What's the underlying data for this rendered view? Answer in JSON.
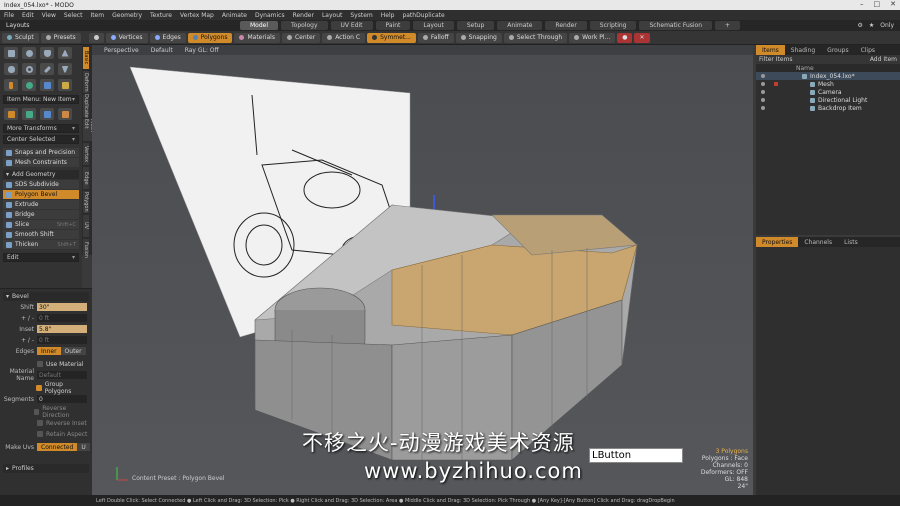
{
  "window": {
    "title": "Index_054.lxo* - MODO",
    "controls": [
      "–",
      "□",
      "✕"
    ]
  },
  "menu": [
    "File",
    "Edit",
    "View",
    "Select",
    "Item",
    "Geometry",
    "Texture",
    "Vertex Map",
    "Animate",
    "Dynamics",
    "Render",
    "Layout",
    "System",
    "Help",
    "pathDuplicate"
  ],
  "layouts": {
    "label": "Layouts",
    "tabs": [
      "Model",
      "Topology",
      "UV Edit",
      "Paint",
      "Layout",
      "Setup",
      "Animate",
      "Render",
      "Scripting",
      "Schematic Fusion"
    ],
    "active": "Model",
    "add": "+",
    "only": "Only"
  },
  "toolbar": {
    "sculpt": "Sculpt",
    "presets": "Presets",
    "vertices": "Vertices",
    "edges": "Edges",
    "polygons": "Polygons",
    "materials": "Materials",
    "center": "Center",
    "action_center": "Action C",
    "symmetry": "Symmet...",
    "falloff": "Falloff",
    "snapping": "Snapping",
    "select_through": "Select Through",
    "work_plane": "Work Pl..."
  },
  "left": {
    "itemmenu": "Item Menu: New Item",
    "transforms": "More Transforms",
    "center_selected": "Center Selected",
    "snaps": "Snaps and Precision",
    "mesh_constraints": "Mesh Constraints",
    "add_geometry": "Add Geometry",
    "tools": [
      {
        "label": "SDS Subdivide",
        "key": "",
        "active": false
      },
      {
        "label": "Polygon Bevel",
        "key": "",
        "active": true
      },
      {
        "label": "Extrude",
        "key": "",
        "active": false
      },
      {
        "label": "Bridge",
        "key": "",
        "active": false
      },
      {
        "label": "Slice",
        "key": "Shift+C",
        "active": false
      },
      {
        "label": "Smooth Shift",
        "key": "",
        "active": false
      },
      {
        "label": "Thicken",
        "key": "Shift+T",
        "active": false
      }
    ],
    "edit_drop": "Edit",
    "vtabs": [
      "Basic",
      "Deform",
      "Duplicate",
      "Mesh Edit",
      "Vertex",
      "Edge",
      "Polygon",
      "UV",
      "Fusion"
    ]
  },
  "bevel": {
    "title": "Bevel",
    "shift_label": "Shift",
    "shift_value": "30\"",
    "shift_sub": "0 ft",
    "inset_label": "Inset",
    "inset_value": "5.8\"",
    "inset_sub": "0 ft",
    "edges_label": "Edges",
    "edges_inner": "Inner",
    "edges_outer": "Outer",
    "use_material": "Use Material",
    "material_label": "Material Name",
    "material_value": "Default",
    "group_polygons": "Group Polygons",
    "segments_label": "Segments",
    "segments_value": "0",
    "reverse_direction": "Reverse Direction",
    "reverse_inset": "Reverse Inset",
    "retain_aspect": "Retain Aspect",
    "make_uvs_label": "Make Uvs",
    "make_uvs_value": "Connected",
    "make_uvs_extra": "U",
    "profiles": "Profiles"
  },
  "viewport": {
    "view": "Perspective",
    "shading": "Default",
    "gl": "Ray GL: Off",
    "watermark_cn": "不移之火-动漫游戏美术资源",
    "watermark_url": "www.byzhihuo.com",
    "lbutton": "LButton",
    "preset": "Content Preset : Polygon Bevel",
    "stats": [
      "3 Polygons",
      "Polygons : Face",
      "Channels: 0",
      "Deformers: OFF",
      "GL: 848",
      "24\""
    ]
  },
  "items": {
    "tabs": [
      "Items",
      "Shading",
      "Groups",
      "Clips"
    ],
    "active": "Items",
    "filter": "Filter Items",
    "add_item": "Add Item",
    "col_name": "Name",
    "tree": [
      {
        "label": "Index_054.lxo*",
        "indent": 0,
        "root": true
      },
      {
        "label": "Mesh",
        "indent": 1,
        "root": false
      },
      {
        "label": "Camera",
        "indent": 1,
        "root": false
      },
      {
        "label": "Directional Light",
        "indent": 1,
        "root": false
      },
      {
        "label": "Backdrop Item",
        "indent": 1,
        "root": false
      }
    ]
  },
  "lower_tabs": [
    "Properties",
    "Channels",
    "Lists"
  ],
  "lower_active": "Properties",
  "status": "Left Double Click: Select Connected ● Left Click and Drag: 3D Selection: Pick ● Right Click and Drag: 3D Selection: Area ● Middle Click and Drag: 3D Selection: Pick Through ● [Any Key]-[Any Button] Click and Drag: dragDropBegin"
}
